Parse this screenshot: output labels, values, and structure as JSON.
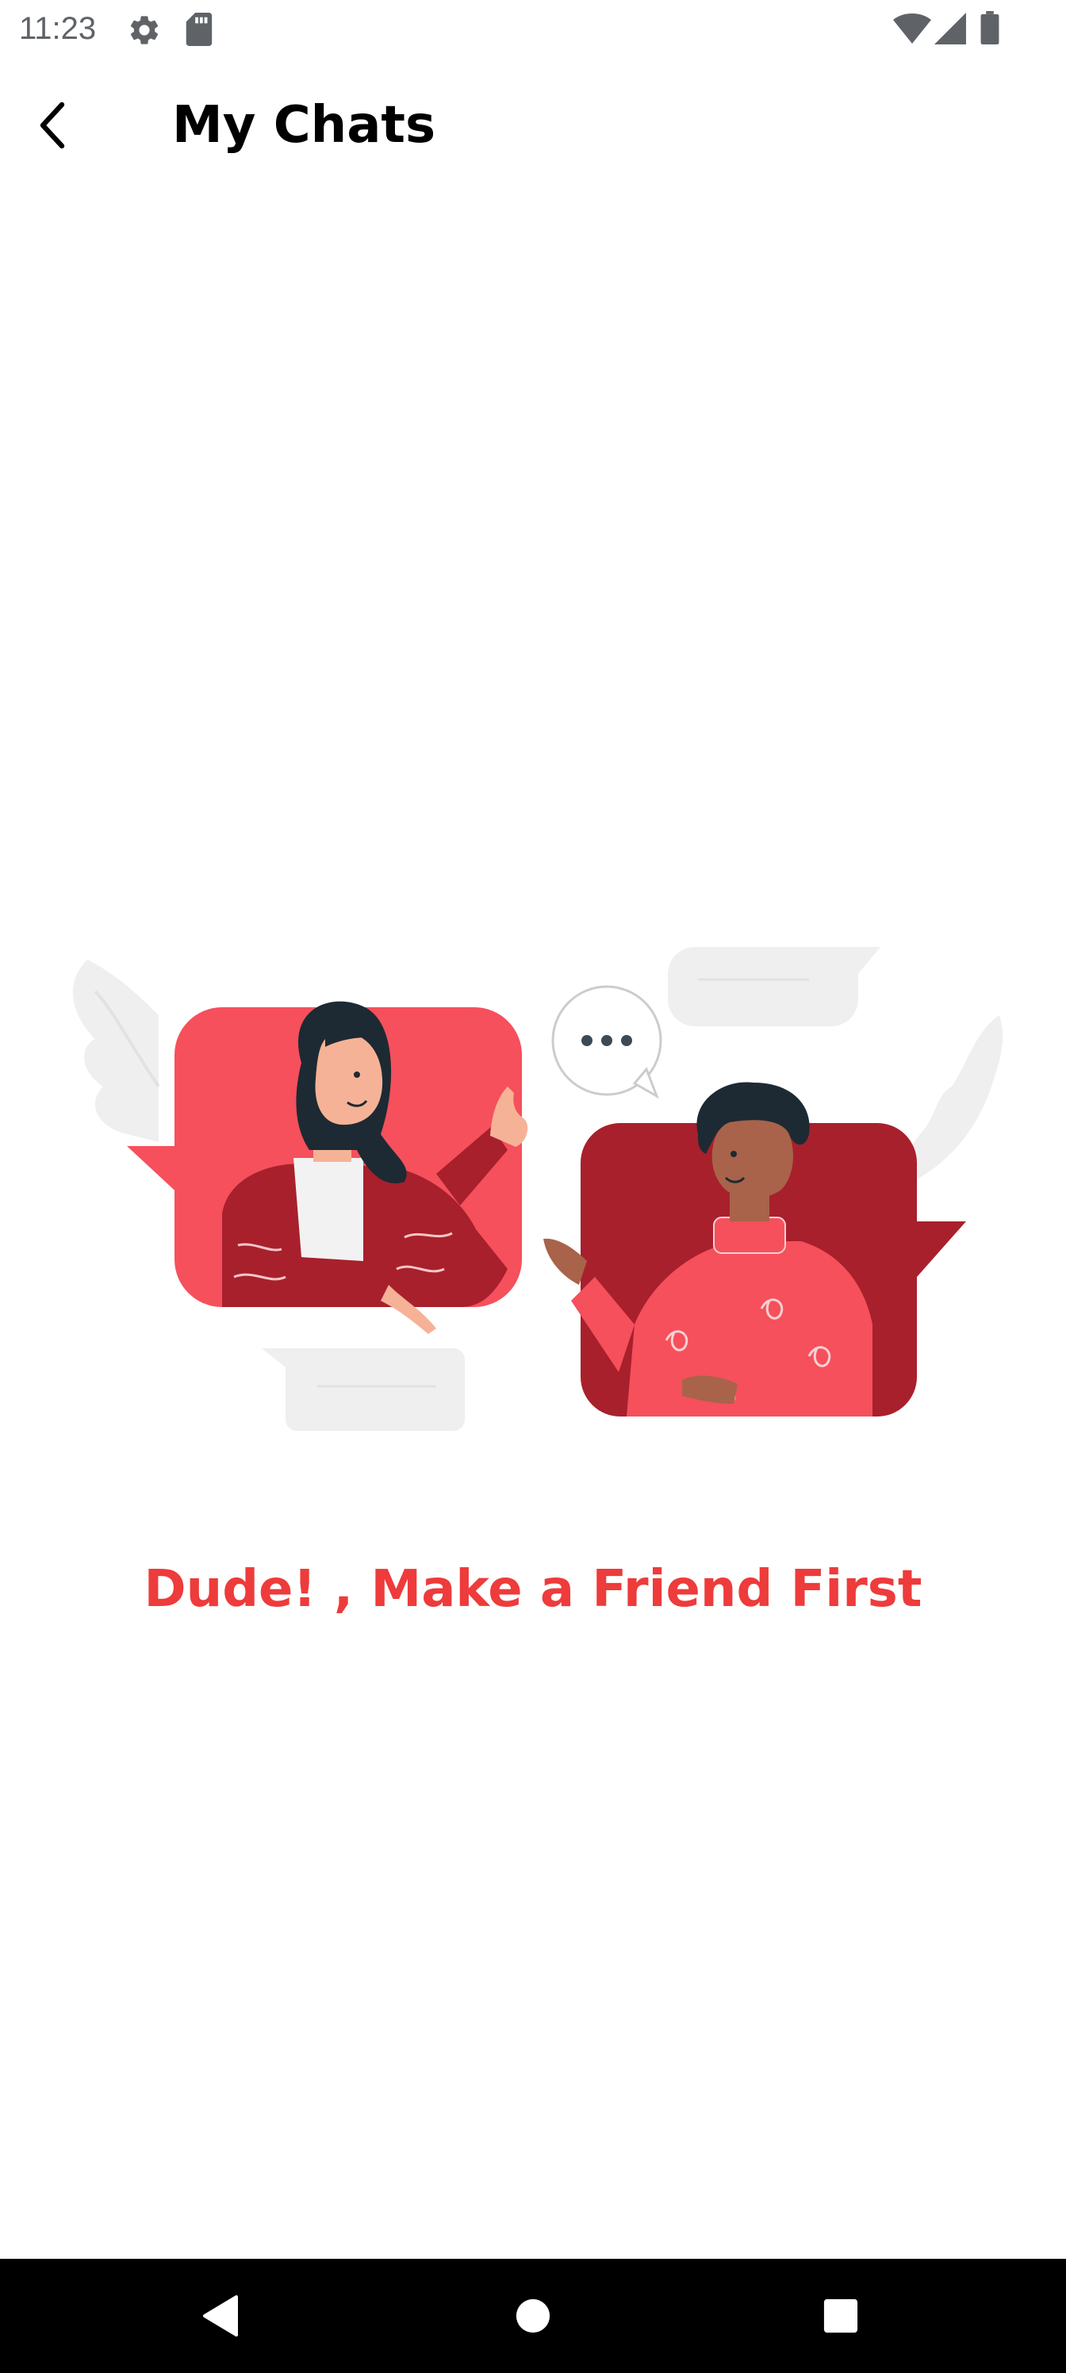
{
  "status_bar": {
    "time": "11:23",
    "icons": [
      "gear-icon",
      "sd-card-icon",
      "wifi-icon",
      "cell-signal-icon",
      "battery-icon"
    ]
  },
  "app_bar": {
    "title": "My Chats",
    "back_icon": "chevron-left-icon"
  },
  "empty_state": {
    "illustration": "two-people-chatting-illustration",
    "message": "Dude! , Make a Friend First"
  },
  "nav_bar": {
    "icons": [
      "back-triangle-icon",
      "home-circle-icon",
      "recents-square-icon"
    ]
  },
  "colors": {
    "accent": "#ee3b3b",
    "title_text": "#000000",
    "status_icons": "#5f6368",
    "nav_background": "#000000",
    "nav_icons": "#ffffff",
    "card_light_red": "#f5505c",
    "card_dark_red": "#a8202c",
    "background": "#ffffff"
  }
}
